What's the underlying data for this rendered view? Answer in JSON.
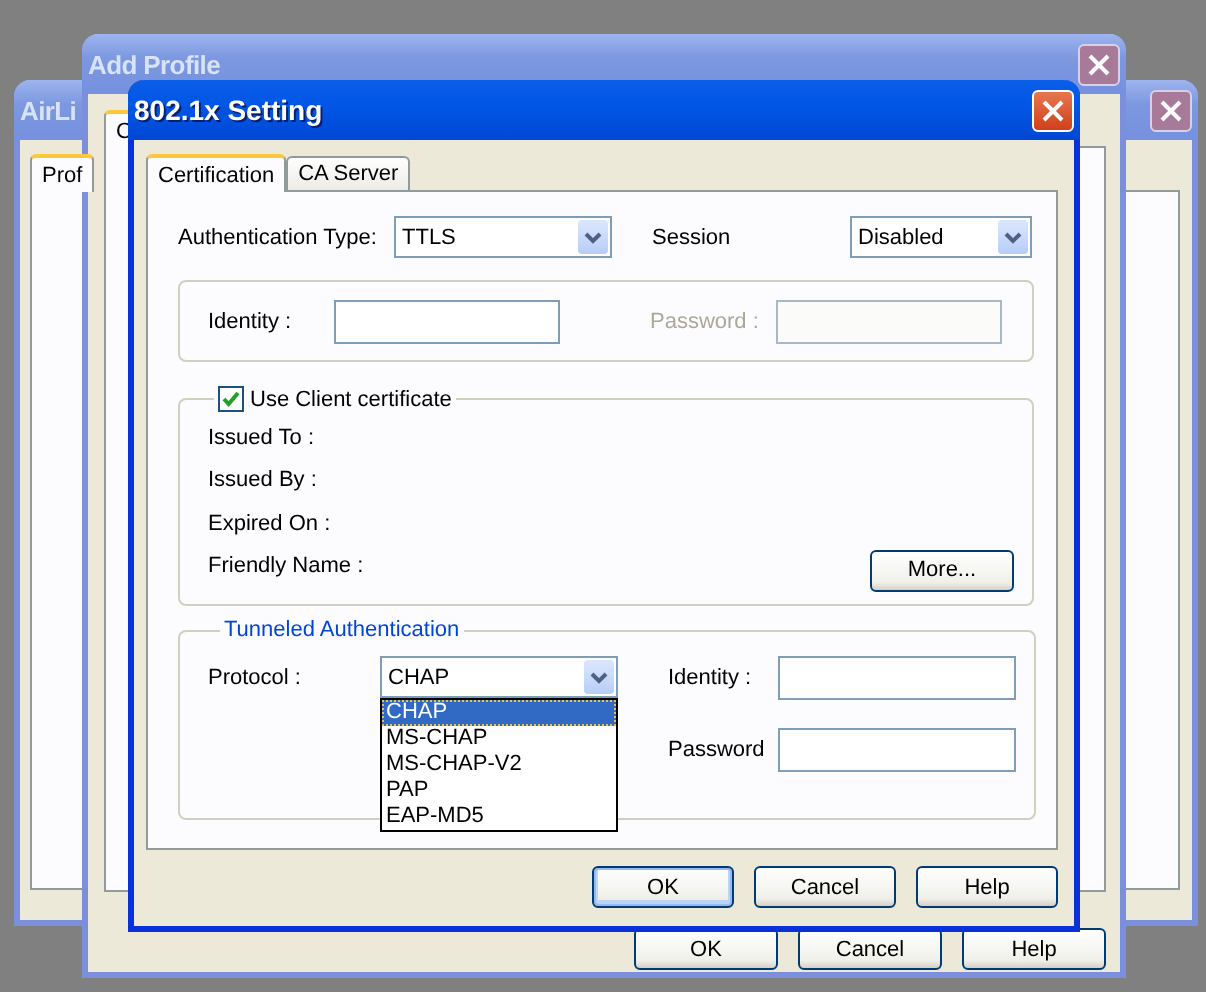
{
  "windows": [
    {
      "title": "AirLi",
      "active": false,
      "tabs": [
        {
          "label": "Prof",
          "selected": true
        }
      ]
    },
    {
      "title": "Add Profile",
      "active": false,
      "tabs": [
        {
          "label": "C",
          "selected": true
        }
      ],
      "buttons": [
        "OK",
        "Cancel",
        "Help"
      ]
    }
  ],
  "dialog": {
    "title": "802.1x Setting",
    "active": true,
    "tabs": [
      {
        "label": "Certification",
        "selected": true
      },
      {
        "label": "CA Server",
        "selected": false
      }
    ],
    "auth_type": {
      "label": "Authentication Type:",
      "value": "TTLS"
    },
    "session": {
      "label": "Session",
      "value": "Disabled"
    },
    "identity": {
      "label": "Identity :",
      "disabled": false
    },
    "password": {
      "label": "Password :",
      "disabled": true
    },
    "client_certificate": {
      "label": "Use Client certificate",
      "checked": true,
      "fields": [
        "Issued To :",
        "Issued By :",
        "Expired On :",
        "Friendly Name :"
      ],
      "more_button": "More..."
    },
    "tunneled": {
      "title": "Tunneled Authentication",
      "protocol": {
        "label": "Protocol :",
        "value": "CHAP",
        "expanded": true,
        "options": [
          {
            "label": "CHAP",
            "selected": true
          },
          {
            "label": "MS-CHAP",
            "selected": false
          },
          {
            "label": "MS-CHAP-V2",
            "selected": false
          },
          {
            "label": "PAP",
            "selected": false
          },
          {
            "label": "EAP-MD5",
            "selected": false
          }
        ]
      },
      "identity": {
        "label": "Identity :"
      },
      "password": {
        "label": "Password"
      }
    },
    "buttons": [
      {
        "label": "OK",
        "default": true
      },
      {
        "label": "Cancel",
        "default": false
      },
      {
        "label": "Help",
        "default": false
      }
    ]
  }
}
